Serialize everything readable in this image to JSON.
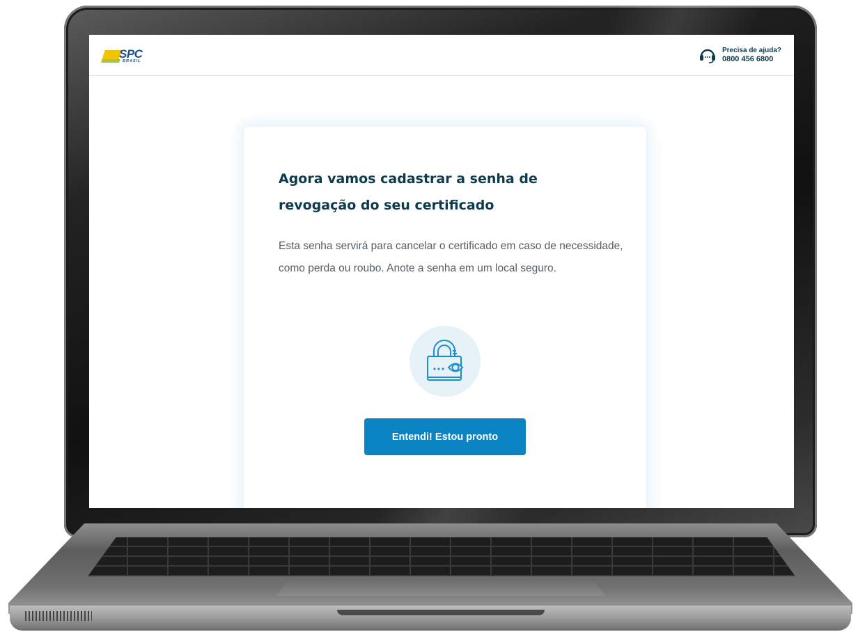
{
  "header": {
    "logo_text": "SPC",
    "logo_sub": "BRASIL",
    "help_question": "Precisa de ajuda?",
    "help_phone": "0800 456 6800"
  },
  "card": {
    "title": "Agora vamos cadastrar a senha de revogação do seu certificado",
    "description": "Esta senha servirá para cancelar o certificado em caso de necessidade, como perda ou roubo. Anote a senha em um local seguro.",
    "illustration_icon": "padlock-password-eye-icon",
    "button_label": "Entendi! Estou pronto"
  },
  "colors": {
    "primary_button": "#0b84c3",
    "title_text": "#0d3b4c",
    "body_text": "#555d66",
    "logo_yellow": "#f2c400",
    "logo_blue": "#1a4f93",
    "icon_blue": "#1a8fcf",
    "icon_circle": "#e6f1f8"
  },
  "icons": {
    "help": "headset-icon",
    "logo": "spc-brasil-logo"
  }
}
